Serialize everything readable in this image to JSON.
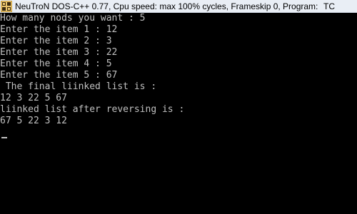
{
  "window": {
    "title": "NeuTroN DOS-C++ 0.77, Cpu speed: max 100% cycles, Frameskip  0, Program:",
    "program_name": "TC",
    "icon": "dos-box-icon"
  },
  "colors": {
    "console_bg": "#000000",
    "console_text": "#c0c0c0",
    "titlebar_bg": "#e9eef5"
  },
  "console": {
    "lines": [
      "How many nods you want : 5",
      "Enter the item 1 : 12",
      "Enter the item 2 : 3",
      "Enter the item 3 : 22",
      "Enter the item 4 : 5",
      "Enter the item 5 : 67",
      " The final liinked list is :",
      "12 3 22 5 67",
      "liinked list after reversing is :",
      "67 5 22 3 12"
    ]
  }
}
